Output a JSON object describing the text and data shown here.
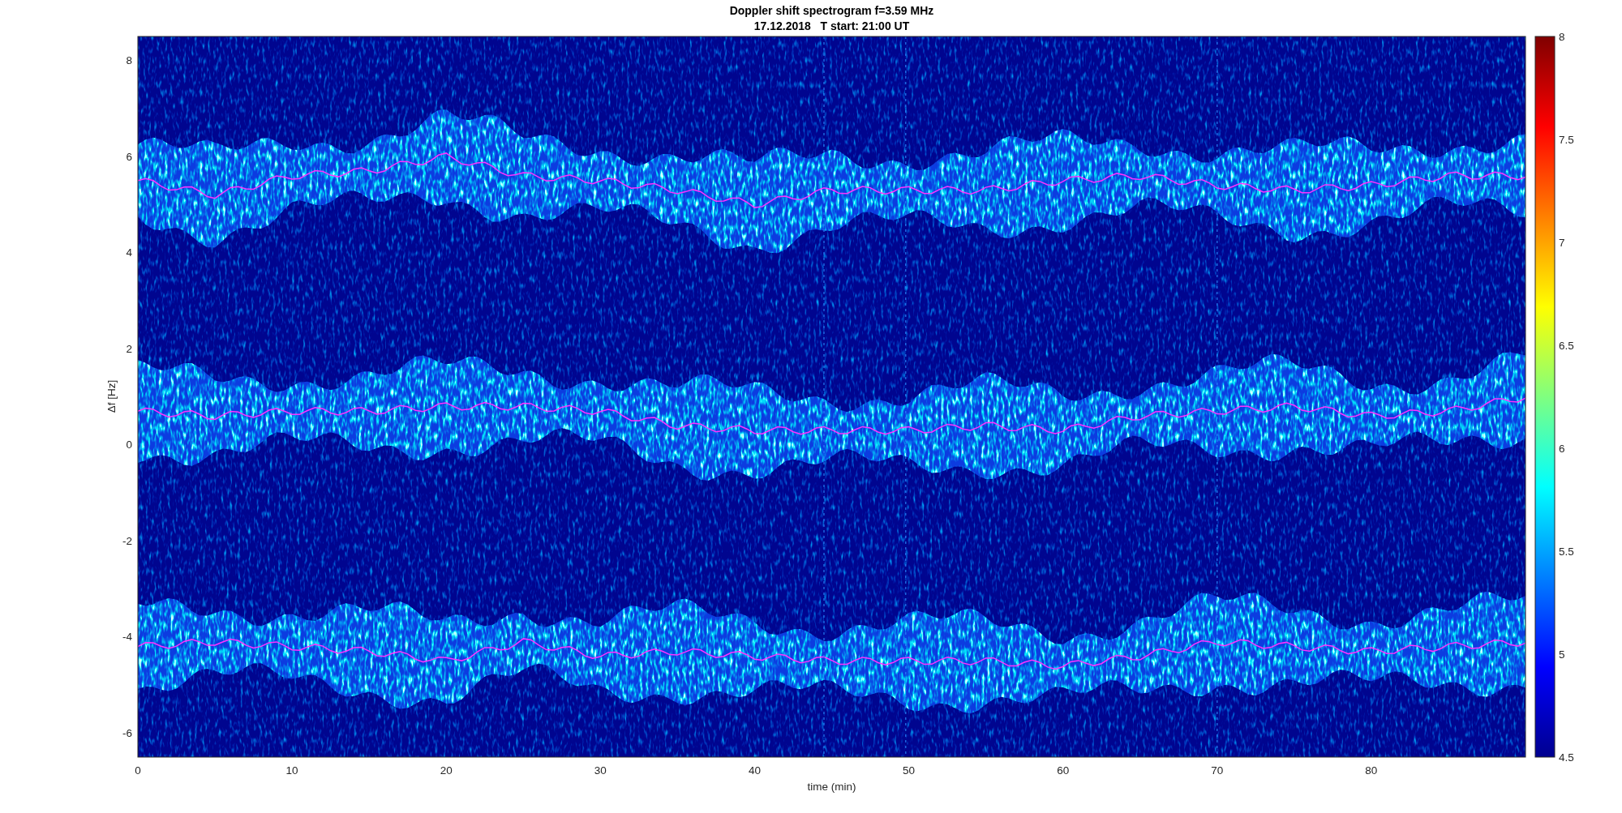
{
  "figure": {
    "title_lines": [
      "Doppler shift spectrogram f=3.59 MHz",
      "17.12.2018   T start: 21:00 UT"
    ],
    "x_axis": {
      "label": "time (min)",
      "ticks": [
        "0",
        "10",
        "20",
        "30",
        "40",
        "50",
        "60",
        "70",
        "80"
      ]
    },
    "y_axis": {
      "label": "Δf [Hz]",
      "ticks": [
        "8",
        "6",
        "4",
        "2",
        "0",
        "-2",
        "-4",
        "-6"
      ]
    },
    "colorbar": {
      "ticks": [
        "8",
        "7.5",
        "7",
        "6.5",
        "6",
        "5.5",
        "5",
        "4.5"
      ]
    }
  }
}
